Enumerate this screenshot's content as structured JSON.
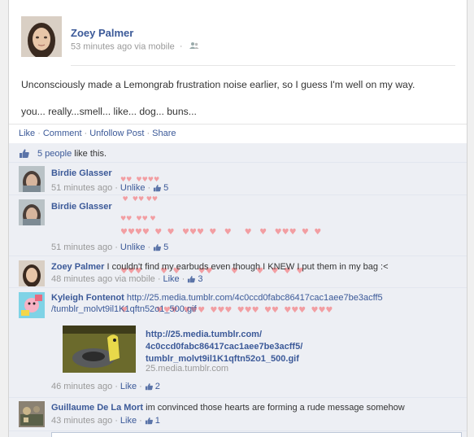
{
  "post": {
    "author": "Zoey Palmer",
    "time": "53 minutes ago",
    "via": "via mobile",
    "sep": "·",
    "text_line1": "Unconsciously made a Lemongrab frustration noise earlier, so I guess I'm well on my way.",
    "text_line2": "you... really...smell... like... dog... buns..."
  },
  "actions": {
    "like": "Like",
    "comment": "Comment",
    "unfollow": "Unfollow Post",
    "share": "Share",
    "dot": "·"
  },
  "likes": {
    "count_link": "5 people",
    "suffix": " like this."
  },
  "comments": [
    {
      "name": "Birdie Glasser",
      "text": "",
      "hearts": [
        "♥♥  ♥♥♥♥",
        " ♥  ♥♥ ♥♥",
        "♥♥  ♥♥ ♥"
      ],
      "time": "51 minutes ago",
      "action": "Unlike",
      "likes": "5"
    },
    {
      "name": "Birdie Glasser",
      "text": "",
      "hearts": [
        "♥♥♥♥  ♥  ♥   ♥♥♥  ♥   ♥     ♥   ♥   ♥♥♥  ♥  ♥",
        "♥♥♥       ♥  ♥       ♥♥       ♥       ♥   ♥  ♥  ♥",
        "♥           ♥♥♥  ♥♥♥  ♥♥♥  ♥♥♥  ♥♥  ♥♥♥  ♥♥♥"
      ],
      "time": "51 minutes ago",
      "action": "Unlike",
      "likes": "5"
    },
    {
      "name": "Zoey Palmer",
      "text": "I couldn't find my earbuds even though I KNEW I put them in my bag :<",
      "time": "48 minutes ago",
      "via": "via mobile",
      "action": "Like",
      "likes": "3"
    },
    {
      "name": "Kyleigh Fontenot",
      "text_line1": "http://25.media.tumblr.com/4c0ccd0fabc86417cac1aee7be3acff5",
      "text_line2": "/tumblr_molvt9il1K1qftn52o1_500.gif",
      "attach_title": "http://25.media.tumblr.com/ 4c0ccd0fabc86417cac1aee7be3acff5/ tumblr_molvt9il1K1qftn52o1_500.gif",
      "attach_domain": "25.media.tumblr.com",
      "time": "46 minutes ago",
      "action": "Like",
      "likes": "2"
    },
    {
      "name": "Guillaume De La Mort",
      "text": "im convinced those hearts are forming a rude message somehow",
      "time": "43 minutes ago",
      "action": "Like",
      "likes": "1"
    }
  ],
  "colors": {
    "link": "#3b5998",
    "muted": "#999999",
    "ufi_bg": "#edeff4",
    "heart": "#f29ea2"
  }
}
